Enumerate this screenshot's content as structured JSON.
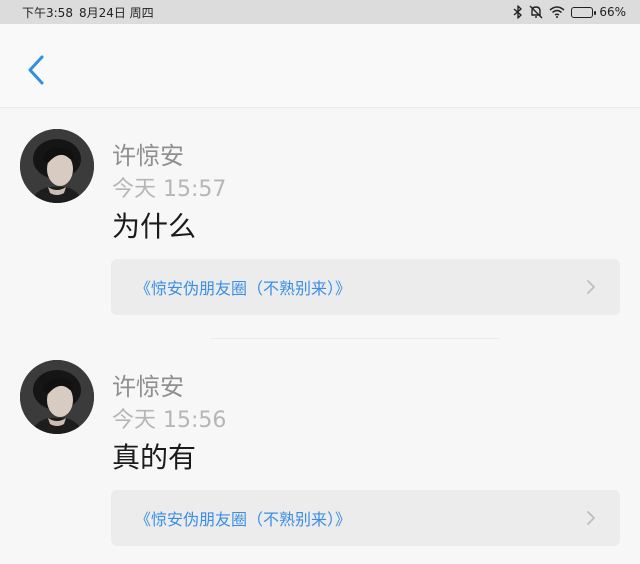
{
  "status_bar": {
    "time": "下午3:58",
    "date": "8月24日 周四",
    "battery": "66%",
    "battery_level": 0.66,
    "icons": [
      "bluetooth-icon",
      "mute-icon",
      "wifi-icon",
      "battery-icon"
    ]
  },
  "nav": {
    "back_icon": "chevron-left-icon",
    "accent_color": "#2f8fe0"
  },
  "messages": [
    {
      "author": "许惊安",
      "time": "今天 15:57",
      "content": "为什么",
      "link": "《惊安伪朋友圈（不熟别来）》"
    },
    {
      "author": "许惊安",
      "time": "今天 15:56",
      "content": "真的有",
      "link": "《惊安伪朋友圈（不熟别来）》"
    }
  ]
}
